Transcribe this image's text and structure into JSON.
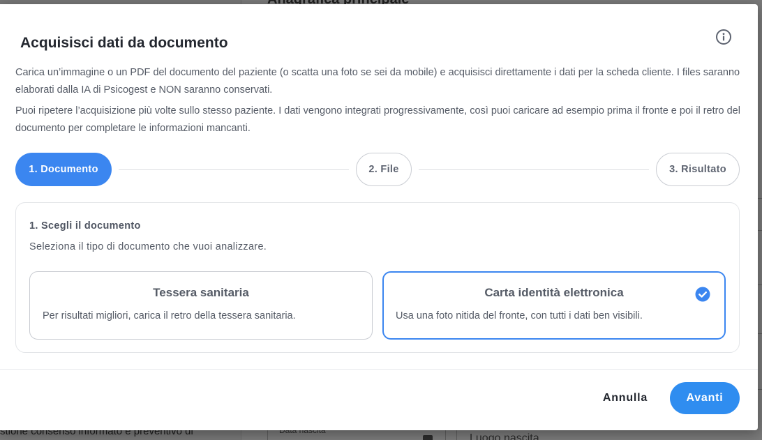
{
  "background": {
    "section_title": "Anagrafica principale",
    "left_text": "stione consenso informato e preventivo di",
    "field_birthdate_label": "Data nascita",
    "field_birthplace_label": "Luogo nascita"
  },
  "modal": {
    "title": "Acquisisci dati da documento",
    "description_1": "Carica un’immagine o un PDF del documento del paziente (o scatta una foto se sei da mobile) e acquisisci direttamente i dati per la scheda cliente. I files saranno elaborati dalla IA di Psicogest e NON saranno conservati.",
    "description_2": "Puoi ripetere l’acquisizione più volte sullo stesso paziente. I dati vengono integrati progressivamente, così puoi caricare ad esempio prima il fronte e poi il retro del documento per completare le informazioni mancanti.",
    "steps": [
      {
        "label": "1. Documento",
        "active": true
      },
      {
        "label": "2. File",
        "active": false
      },
      {
        "label": "3. Risultato",
        "active": false
      }
    ],
    "panel": {
      "title": "1. Scegli il documento",
      "subtitle": "Seleziona il tipo di documento che vuoi analizzare.",
      "options": [
        {
          "title": "Tessera sanitaria",
          "description": "Per risultati migliori, carica il retro della tessera sanitaria.",
          "selected": false
        },
        {
          "title": "Carta identità elettronica",
          "description": "Usa una foto nitida del fronte, con tutti i dati ben visibili.",
          "selected": true
        }
      ]
    },
    "footer": {
      "cancel_label": "Annulla",
      "next_label": "Avanti"
    }
  },
  "icons": {
    "info": "info-icon",
    "selected": "check-circle-icon"
  },
  "colors": {
    "primary": "#3b86f0",
    "button_primary": "#2f8df0",
    "text_dark": "#23272f",
    "text_muted": "#555b66",
    "border": "#c9ccd2"
  }
}
